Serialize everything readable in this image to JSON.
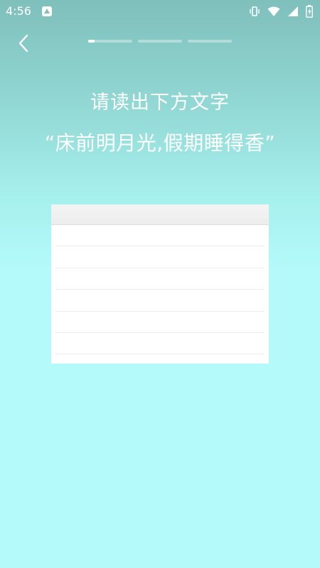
{
  "status_bar": {
    "time": "4:56",
    "icons": [
      "app-notification-icon",
      "vibrate-icon",
      "wifi-icon",
      "signal-icon",
      "battery-charging-icon"
    ]
  },
  "nav": {
    "back_icon": "chevron-left-icon"
  },
  "progress": {
    "steps_total": 3,
    "current_step": 1,
    "current_step_fill": 0.15
  },
  "main": {
    "instruction": "请读出下方文字",
    "phrase": "“床前明月光,假期睡得香”"
  },
  "colors": {
    "bg_top": "#7fbfbc",
    "bg_bottom": "#b4fafa",
    "text": "#ffffff",
    "card": "#ffffff"
  }
}
